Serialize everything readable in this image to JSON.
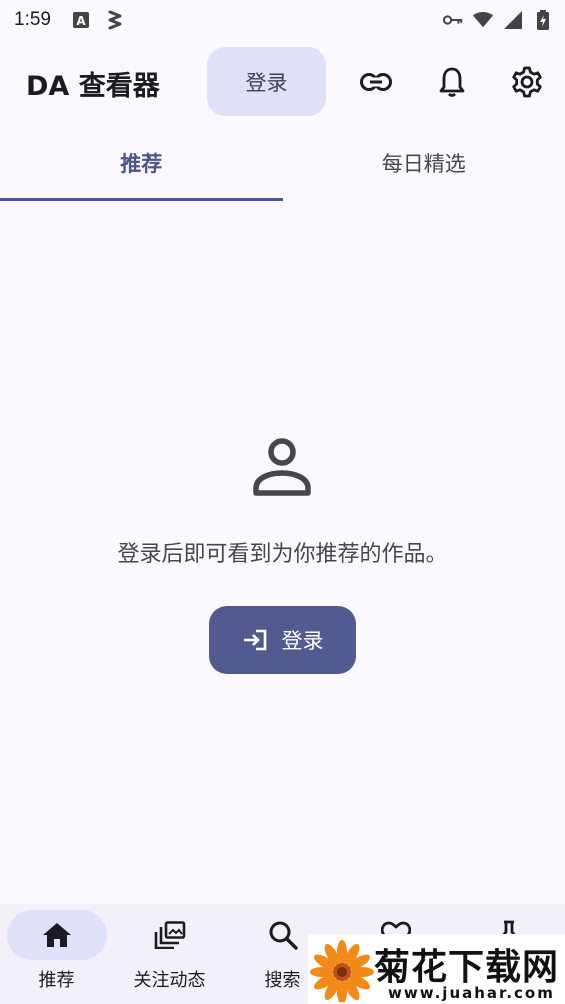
{
  "status_bar": {
    "time": "1:59",
    "left_icons": [
      "a-notification-icon",
      "signal-sync-icon"
    ],
    "right_icons": [
      "vpn-key-icon",
      "wifi-icon",
      "cell-signal-icon",
      "battery-icon"
    ]
  },
  "app_bar": {
    "title": "DA 查看器",
    "login_label": "登录",
    "icons": [
      "link-icon",
      "bell-icon",
      "gear-icon"
    ]
  },
  "tabs": [
    {
      "label": "推荐",
      "active": true
    },
    {
      "label": "每日精选",
      "active": false
    }
  ],
  "empty_state": {
    "icon": "person-icon",
    "message": "登录后即可看到为你推荐的作品。",
    "button_label": "登录",
    "button_icon": "login-arrow-icon"
  },
  "bottom_nav": [
    {
      "label": "推荐",
      "icon": "home-icon",
      "active": true
    },
    {
      "label": "关注动态",
      "icon": "stacked-photos-icon",
      "active": false
    },
    {
      "label": "搜索",
      "icon": "search-icon",
      "active": false
    },
    {
      "label": "",
      "icon": "heart-icon",
      "active": false
    },
    {
      "label": "",
      "icon": "pin-icon",
      "active": false
    }
  ],
  "watermark": {
    "title": "菊花下载网",
    "url": "www.juahar.com"
  },
  "colors": {
    "background": "#fbf8ff",
    "primary": "#525b91",
    "primary_container": "#dfe1f9",
    "nav_background": "#f3f0f9"
  }
}
